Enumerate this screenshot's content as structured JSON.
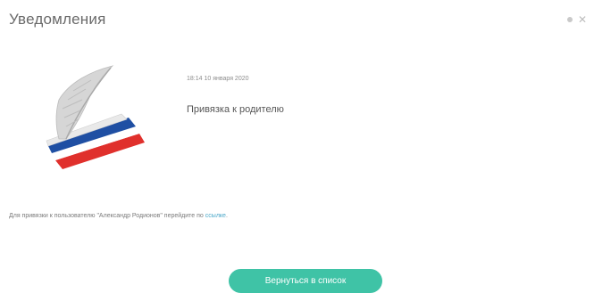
{
  "header": {
    "title": "Уведомления",
    "close_glyph": "✕"
  },
  "notification": {
    "timestamp": "18:14 10 января 2020",
    "subject": "Привязка к родителю",
    "body_prefix": "Для привязки к пользователю \"Александр Родионов\" перейдите по ",
    "link_text": "ссылке",
    "body_suffix": "."
  },
  "actions": {
    "back_label": "Вернуться в список"
  },
  "icons": {
    "status_dot": "dot-icon",
    "close": "close-icon",
    "logo": "quill-book-logo"
  },
  "colors": {
    "accent": "#3fc3a6",
    "link": "#4aa7c9",
    "flag_blue": "#1f4fa3",
    "flag_red": "#e0302c"
  }
}
